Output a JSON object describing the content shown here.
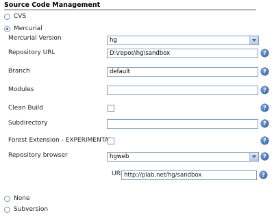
{
  "section": {
    "title": "Source Code Management"
  },
  "scm_options": {
    "cvs": "CVS",
    "mercurial": "Mercurial",
    "none": "None",
    "subversion": "Subversion"
  },
  "mercurial": {
    "version_label": "Mercurial Version",
    "version_value": "hg",
    "repo_url_label": "Repository URL",
    "repo_url_value": "D:\\repos\\hg\\sandbox",
    "branch_label": "Branch",
    "branch_value": "default",
    "modules_label": "Modules",
    "modules_value": "",
    "clean_build_label": "Clean Build",
    "subdirectory_label": "Subdirectory",
    "subdirectory_value": "",
    "forest_label": "Forest Extension - EXPERIMENTAL",
    "browser_label": "Repository browser",
    "browser_value": "hgweb",
    "browser_url_label": "URL",
    "browser_url_value": "http://plab.net/hg/sandbox"
  },
  "help_glyph": "?"
}
